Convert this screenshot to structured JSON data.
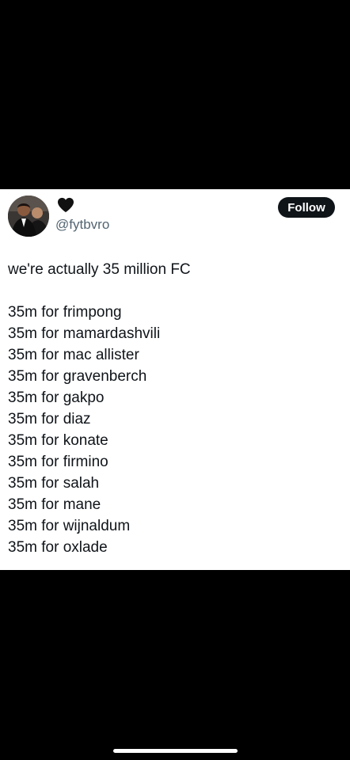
{
  "tweet": {
    "handle": "@fytbvro",
    "display_icon": "black-heart-icon",
    "follow_label": "Follow",
    "headline": "we're actually 35 million FC",
    "lines": [
      "35m for frimpong",
      "35m for mamardashvili",
      "35m for mac allister",
      "35m for gravenberch",
      "35m for gakpo",
      "35m for diaz",
      "35m for konate",
      "35m for firmino",
      "35m for salah",
      "35m for mane",
      "35m for wijnaldum",
      "35m for oxlade"
    ]
  },
  "colors": {
    "background": "#000000",
    "card": "#ffffff",
    "text": "#0f1419",
    "handle": "#536471",
    "follow_bg": "#0f1419",
    "follow_text": "#ffffff"
  }
}
